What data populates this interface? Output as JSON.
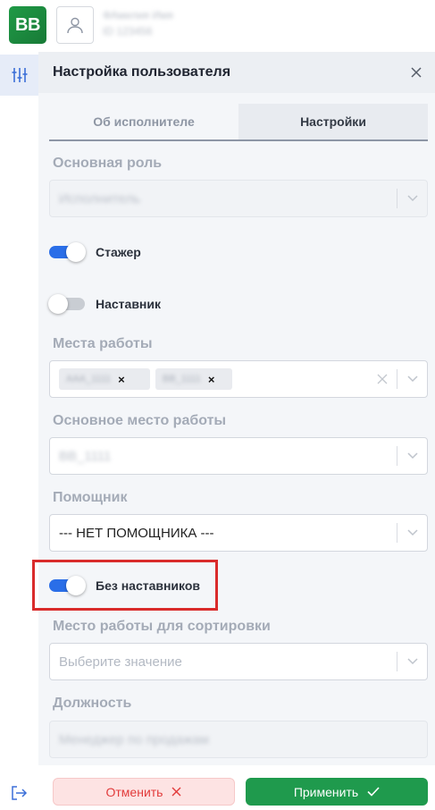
{
  "header": {
    "logo_text": "BB",
    "user_name": "ФАмилия Имя",
    "user_id": "ID 123456"
  },
  "panel": {
    "title": "Настройка пользователя"
  },
  "tabs": [
    {
      "label": "Об исполнителе",
      "active": false
    },
    {
      "label": "Настройки",
      "active": true
    }
  ],
  "fields": {
    "main_role": {
      "label": "Основная роль",
      "value": "Исполнитель"
    },
    "workplaces": {
      "label": "Места работы",
      "chips": [
        "ААА_1111",
        "ВВ_1111"
      ]
    },
    "main_workplace": {
      "label": "Основное место работы",
      "value": "ВВ_1111"
    },
    "assistant": {
      "label": "Помощник",
      "value": "--- НЕТ ПОМОЩНИКА ---"
    },
    "sort_workplace": {
      "label": "Место работы для сортировки",
      "placeholder": "Выберите значение"
    },
    "position": {
      "label": "Должность",
      "value": "Менеджер по продажам"
    }
  },
  "toggles": {
    "intern": {
      "label": "Стажер",
      "on": true
    },
    "mentor": {
      "label": "Наставник",
      "on": false
    },
    "no_mentors": {
      "label": "Без наставников",
      "on": true
    }
  },
  "footer": {
    "cancel_label": "Отменить",
    "apply_label": "Применить"
  },
  "colors": {
    "brand_green": "#1f9a4d",
    "toggle_on": "#2a6ee8",
    "cancel_red": "#e23b3b",
    "highlight_red": "#d92b2b"
  },
  "icons": {
    "logo": "bb-logo",
    "avatar": "user-icon",
    "rail_settings": "sliders-icon",
    "rail_logout": "logout-icon",
    "close": "close-icon",
    "chevron": "chevron-down-icon",
    "clear": "clear-icon",
    "cancel": "x-icon",
    "apply": "check-icon"
  }
}
